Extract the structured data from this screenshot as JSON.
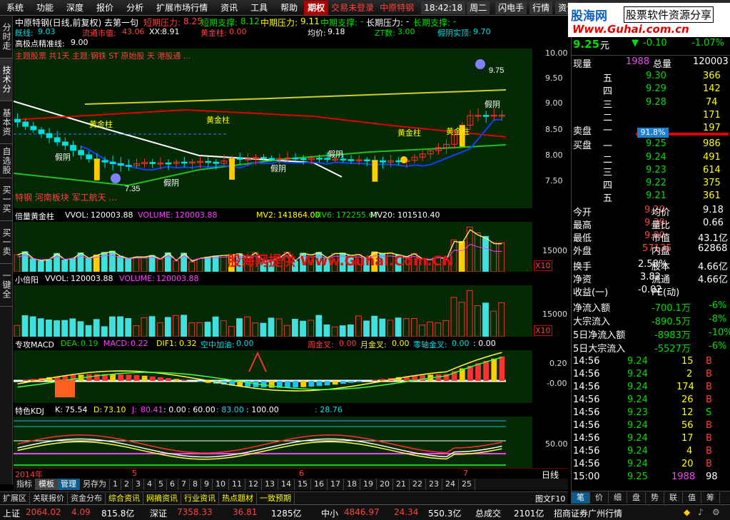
{
  "menu": {
    "items": [
      "系统",
      "功能",
      "深度",
      "报价",
      "分析",
      "扩展市场行情",
      "资讯",
      "工具",
      "帮助"
    ],
    "options_tab": "期权",
    "trade_status": "交易未登录",
    "stock_name": "中原特钢",
    "time": "18:42:18",
    "weekday": "周二",
    "flash": "闪电手",
    "quote": "行情",
    "info": "资讯"
  },
  "brand": {
    "logo_cn": "股海网",
    "slogan": "股票软件资源分享",
    "url": "Www.Guhai.com.cn"
  },
  "left_tabs": [
    "分时走势",
    "技术分析",
    "基本资料",
    "自选股",
    "买一买入",
    "买一卖出",
    "一键全撤"
  ],
  "kline": {
    "title": "中原特钢(日线,前复权) 去第一句",
    "short_pressure_label": "短期压力:",
    "short_pressure": "8.25",
    "short_support_label": "短期支撑:",
    "short_support": "8.12",
    "mid_pressure_label": "中期压力:",
    "mid_pressure": "9.11",
    "mid_support_label": "中期支撑:",
    "mid_support": "-",
    "long_pressure_label": "长期压力:",
    "long_pressure": "-",
    "long_support_label": "长期支撑:",
    "long_support": "-",
    "row2": [
      {
        "label": "既线:",
        "value": "9.03"
      },
      {
        "label": "流通市值:",
        "value": "43.06"
      },
      {
        "label": "XX:",
        "value": "8.91"
      },
      {
        "label": "黄金柱:",
        "value": "0.00"
      },
      {
        "label": "均价:",
        "value": "9.18"
      },
      {
        "label": "ZT数:",
        "value": "3.00"
      },
      {
        "label": "假阴实顶:",
        "value": "9.70"
      }
    ],
    "row3_label": "高极点精准线:",
    "row3_value": "9.00",
    "row4_text": "主题股票 共1天 主题:钢铁 ST 原始股 天 港股通 ...",
    "concept_text": "特钢 河南板块 军工航天 ...",
    "y_labels": [
      "10.00",
      "9.50",
      "9.00",
      "8.50",
      "8.00",
      "7.50"
    ],
    "annotations": [
      {
        "text": "黄金柱"
      },
      {
        "text": "黄金柱"
      },
      {
        "text": "黄金柱"
      },
      {
        "text": "黄金柱"
      },
      {
        "text": "假阴"
      },
      {
        "text": "假阴"
      },
      {
        "text": "假阴"
      },
      {
        "text": "假阴"
      },
      {
        "text": "假阴"
      },
      {
        "text": "7.35"
      },
      {
        "text": "9.75"
      }
    ]
  },
  "vol1": {
    "title": "倍量黄金柱",
    "vol_label": "VVOL:",
    "vol_value": "120003.88",
    "volume_label": "VOLUME:",
    "volume_value": "120003.88",
    "mv2_label": "MV2:",
    "mv2": "141864.00",
    "mv6_label": "MV6:",
    "mv6": "172255.67",
    "mv20_label": "MV20:",
    "mv20": "101510.40",
    "y_label": "15000",
    "x10": "X10",
    "watermark": "股海网提供 Www.Guhai.Com.CN"
  },
  "vol2": {
    "title": "小倍阳",
    "vol_label": "VVOL:",
    "vol_value": "120003.88",
    "volume_label": "VOLUME:",
    "volume_value": "120003.88",
    "y_label": "15000",
    "x10": "X10"
  },
  "macd": {
    "title": "专攻MACD",
    "dea_label": "DEA:",
    "dea": "0.19",
    "macd_label": "MACD:",
    "macd": "0.22",
    "dif_label": "DIF1:",
    "dif": "0.32",
    "air_label": "空中加油:",
    "air": "0.00",
    "week_label": "周金叉:",
    "week": "0.00",
    "month_label": "月金叉:",
    "month": "0.00",
    "zero_label": "零轴金叉:",
    "zero": "0.00",
    "extra": ": 0.00",
    "y_labels": [
      "0.20",
      "-0.00"
    ]
  },
  "kdj": {
    "title": "特色KDJ",
    "k_label": "K:",
    "k": "75.54",
    "d_label": "D:",
    "d": "73.10",
    "j_label": "J:",
    "j": "80.41",
    "v1": ": 0.00",
    "v2": ": 60.00",
    "v3": ": 83.00",
    "v4": ": 100.00",
    "v5": ": 28.76",
    "y_label": "50.00"
  },
  "timeline": {
    "year": "2014年",
    "months": [
      "5",
      "6",
      "7"
    ],
    "period": "日线"
  },
  "bottom_tabs": {
    "left": [
      "指标",
      "模板",
      "管理",
      "另存为"
    ],
    "numbers": [
      "1",
      "2",
      "3",
      "4",
      "5",
      "6",
      "7",
      "8",
      "9",
      "10",
      "11",
      "12",
      "13",
      "14",
      "15",
      "16",
      "17",
      "18",
      "19",
      "20",
      "21",
      "22",
      "23",
      "24",
      "25"
    ]
  },
  "nav_tabs": [
    "扩展区",
    "关联报价",
    "资金分布",
    "综合资讯",
    "网摘资讯",
    "行业资讯",
    "热点题材",
    "一致预期"
  ],
  "right_panel": {
    "price": "9.25",
    "price_suffix": "元",
    "change": "-0.10",
    "pct": "-1.07%",
    "now_label": "现量",
    "now_val": "1988",
    "total_label": "总量",
    "total_val": "120003",
    "sells": [
      {
        "label": "五",
        "price": "9.30",
        "vol": "366"
      },
      {
        "label": "四",
        "price": "9.29",
        "vol": "142"
      },
      {
        "label": "三",
        "price": "9.28",
        "vol": "74"
      },
      {
        "label": "二",
        "price": "",
        "vol": "171"
      },
      {
        "label": "一",
        "price": "",
        "vol": "197"
      }
    ],
    "sell_title": "卖盘",
    "buy_title": "买盘",
    "ratio": "91.8%",
    "buys": [
      {
        "label": "一",
        "price": "9.25",
        "vol": "986"
      },
      {
        "label": "二",
        "price": "9.24",
        "vol": "491"
      },
      {
        "label": "三",
        "price": "9.23",
        "vol": "614"
      },
      {
        "label": "四",
        "price": "9.22",
        "vol": "375"
      },
      {
        "label": "五",
        "price": "9.21",
        "vol": "361"
      }
    ],
    "stats": [
      {
        "l1": "今开",
        "v1": "9.20",
        "l2": "均价",
        "v2": "9.18"
      },
      {
        "l1": "最高",
        "v1": "9.39",
        "l2": "量比",
        "v2": "0.66"
      },
      {
        "l1": "最低",
        "v1": "9.00",
        "l2": "市值",
        "v2": "43.1亿"
      },
      {
        "l1": "外盘",
        "v1": "57135",
        "l2": "内盘",
        "v2": "62868"
      }
    ],
    "stats2": [
      {
        "l1": "换手",
        "v1": "2.58%",
        "l2": "股本",
        "v2": "4.66亿"
      },
      {
        "l1": "净资",
        "v1": "3.82",
        "l2": "流通",
        "v2": "4.66亿"
      },
      {
        "l1": "收益(一)",
        "v1": "-0.02",
        "l2": "PE(动)",
        "v2": ""
      }
    ],
    "flows": [
      {
        "label": "净流入额",
        "value": "-700.1万",
        "pct": "-6%"
      },
      {
        "label": "大宗流入",
        "value": "-890.5万",
        "pct": "-8%"
      },
      {
        "label": "5日净流入额",
        "value": "-8983万",
        "pct": "-10%"
      },
      {
        "label": "5日大宗流入",
        "value": "-5527万",
        "pct": "-6%"
      }
    ],
    "ticks": [
      {
        "time": "14:56",
        "price": "9.24",
        "vol": "15",
        "bs": "B"
      },
      {
        "time": "14:56",
        "price": "9.24",
        "vol": "2",
        "bs": "B"
      },
      {
        "time": "14:56",
        "price": "9.24",
        "vol": "174",
        "bs": "B"
      },
      {
        "time": "14:56",
        "price": "9.24",
        "vol": "26",
        "bs": "B"
      },
      {
        "time": "14:56",
        "price": "9.23",
        "vol": "12",
        "bs": "S"
      },
      {
        "time": "14:56",
        "price": "9.24",
        "vol": "56",
        "bs": "B"
      },
      {
        "time": "14:56",
        "price": "9.24",
        "vol": "17",
        "bs": "B"
      },
      {
        "time": "14:56",
        "price": "9.24",
        "vol": "4",
        "bs": "B"
      },
      {
        "time": "14:56",
        "price": "9.24",
        "vol": "20",
        "bs": "B"
      },
      {
        "time": "15:00",
        "price": "9.25",
        "vol": "1988",
        "bs": "98"
      }
    ],
    "bottom_tabs": [
      "笔",
      "价",
      "细",
      "盘",
      "势",
      "联",
      "值",
      "筹"
    ],
    "chart_btn": "图文F10"
  },
  "statusbar": {
    "items": [
      {
        "name": "上证",
        "val": "2064.02",
        "chg": "4.09",
        "amt": "815.8亿"
      },
      {
        "name": "深证",
        "val": "7358.33",
        "chg": "36.81",
        "amt": "1285亿"
      },
      {
        "name": "中小",
        "val": "4846.97",
        "chg": "24.34",
        "amt": "550.3亿"
      }
    ],
    "total_label": "总成交",
    "total": "2101亿",
    "broker": "招商证券广州行情"
  },
  "colors": {
    "panel_bg": "#052905",
    "up": "#ff3030",
    "down": "#00e0e0",
    "accent": "#ffff00"
  }
}
